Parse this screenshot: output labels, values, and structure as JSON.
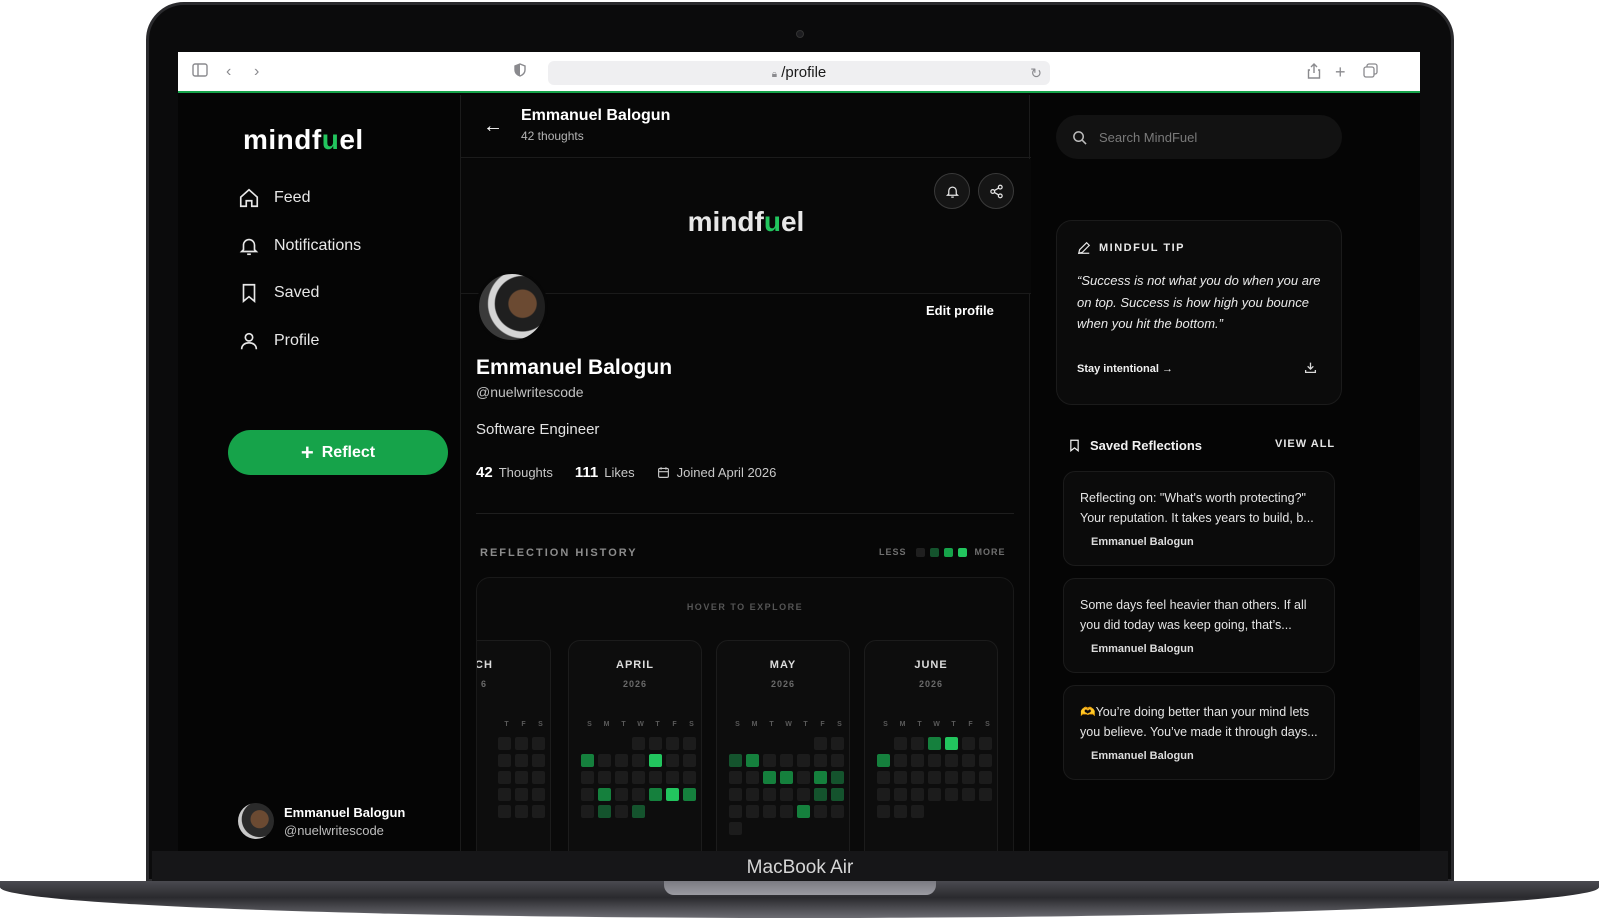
{
  "device": {
    "label": "MacBook Air"
  },
  "browser": {
    "url": "/profile"
  },
  "app": {
    "logo_pre": "mindf",
    "logo_mid": "u",
    "logo_post": "el"
  },
  "sidebar": {
    "items": [
      {
        "label": "Feed",
        "icon": "home-icon"
      },
      {
        "label": "Notifications",
        "icon": "bell-icon"
      },
      {
        "label": "Saved",
        "icon": "bookmark-icon"
      },
      {
        "label": "Profile",
        "icon": "user-icon"
      }
    ],
    "reflect_label": "Reflect",
    "user": {
      "name": "Emmanuel Balogun",
      "handle": "@nuelwritescode"
    }
  },
  "topbar": {
    "name": "Emmanuel Balogun",
    "subtitle": "42 thoughts"
  },
  "profile": {
    "edit_label": "Edit profile",
    "name": "Emmanuel Balogun",
    "handle": "@nuelwritescode",
    "bio": "Software Engineer",
    "thoughts_count": "42",
    "thoughts_label": "Thoughts",
    "likes_count": "111",
    "likes_label": "Likes",
    "joined": "Joined April 2026"
  },
  "history": {
    "title": "REFLECTION HISTORY",
    "legend_less": "LESS",
    "legend_more": "MORE",
    "legend_colors": [
      "#1f1f1f",
      "#14532d",
      "#16a34a",
      "#22c55e"
    ],
    "hover_label": "HOVER TO EXPLORE",
    "level_colors": [
      "#1c1c1c",
      "#14532d",
      "#15803d",
      "#22c55e"
    ],
    "months": [
      {
        "name": "CH",
        "year": "6",
        "dow": [
          "T",
          "F",
          "S"
        ],
        "cols": 3,
        "rows": [
          [
            0,
            0,
            0
          ],
          [
            0,
            0,
            0
          ],
          [
            0,
            0,
            0
          ],
          [
            0,
            0,
            0
          ],
          [
            0,
            0,
            0
          ]
        ]
      },
      {
        "name": "APRIL",
        "year": "2026",
        "dow": [
          "S",
          "M",
          "T",
          "W",
          "T",
          "F",
          "S"
        ],
        "cols": 7,
        "rows": [
          [
            -1,
            -1,
            -1,
            0,
            0,
            0,
            0
          ],
          [
            2,
            0,
            0,
            0,
            3,
            0,
            0
          ],
          [
            0,
            0,
            0,
            0,
            0,
            0,
            0
          ],
          [
            0,
            2,
            0,
            0,
            2,
            3,
            2
          ],
          [
            0,
            1,
            0,
            1,
            -1,
            -1,
            -1
          ]
        ]
      },
      {
        "name": "MAY",
        "year": "2026",
        "dow": [
          "S",
          "M",
          "T",
          "W",
          "T",
          "F",
          "S"
        ],
        "cols": 7,
        "rows": [
          [
            -1,
            -1,
            -1,
            -1,
            -1,
            0,
            0
          ],
          [
            1,
            2,
            0,
            0,
            0,
            0,
            0
          ],
          [
            0,
            0,
            2,
            2,
            0,
            2,
            1
          ],
          [
            0,
            0,
            0,
            0,
            0,
            1,
            1
          ],
          [
            0,
            0,
            0,
            0,
            2,
            0,
            0
          ],
          [
            0,
            -1,
            -1,
            -1,
            -1,
            -1,
            -1
          ]
        ]
      },
      {
        "name": "JUNE",
        "year": "2026",
        "dow": [
          "S",
          "M",
          "T",
          "W",
          "T",
          "F",
          "S"
        ],
        "cols": 7,
        "rows": [
          [
            -1,
            0,
            0,
            2,
            3,
            0,
            0
          ],
          [
            2,
            0,
            0,
            0,
            0,
            0,
            0
          ],
          [
            0,
            0,
            0,
            0,
            0,
            0,
            0
          ],
          [
            0,
            0,
            0,
            0,
            0,
            0,
            0
          ],
          [
            0,
            0,
            0,
            -1,
            -1,
            -1,
            -1
          ]
        ]
      }
    ]
  },
  "right": {
    "search_placeholder": "Search MindFuel",
    "tip": {
      "title": "MINDFUL TIP",
      "quote": "“Success is not what you do when you are on top. Success is how high you bounce when you hit the bottom.”",
      "link": "Stay intentional"
    },
    "saved": {
      "title": "Saved Reflections",
      "view_all": "VIEW ALL",
      "items": [
        {
          "text": "Reflecting on: \"What's worth protecting?\" Your reputation. It takes years to build, b...",
          "author": "Emmanuel Balogun"
        },
        {
          "text": "Some days feel heavier than others. If all you did today was keep going, that’s...",
          "author": "Emmanuel Balogun"
        },
        {
          "text": "🫶You’re doing better than your mind lets you believe. You’ve made it through days...",
          "author": "Emmanuel Balogun"
        }
      ]
    }
  }
}
